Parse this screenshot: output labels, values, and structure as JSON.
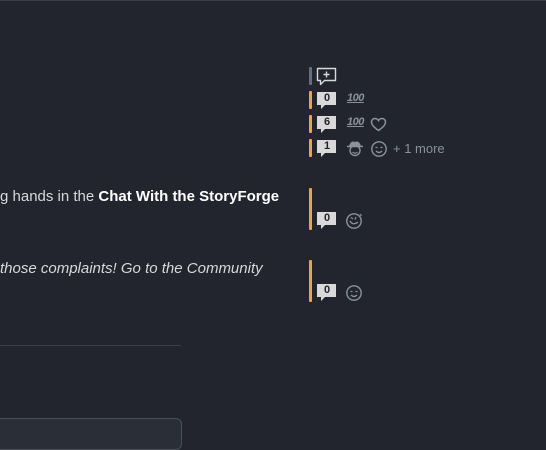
{
  "colors": {
    "accent": "#e8a44a",
    "rail_neutral": "#5f7080",
    "badge_fill": "#d9d9d9",
    "icon": "#8c919a"
  },
  "threads": [
    {
      "count": "0",
      "reactions": [
        "hundred-points"
      ],
      "hundred_label": "100"
    },
    {
      "count": "6",
      "reactions": [
        "hundred-points",
        "heart"
      ],
      "hundred_label": "100"
    },
    {
      "count": "1",
      "reactions": [
        "cowboy-face",
        "smiling-face"
      ],
      "more_label": "+ 1 more"
    }
  ],
  "messages": [
    {
      "text_plain": "g hands in the ",
      "text_bold": "Chat With the StoryForge",
      "count": "0",
      "reaction": "rolling-laughing-face"
    },
    {
      "text_italic": " those complaints! Go to the Community",
      "count": "0",
      "reaction": "smiling-face"
    }
  ]
}
